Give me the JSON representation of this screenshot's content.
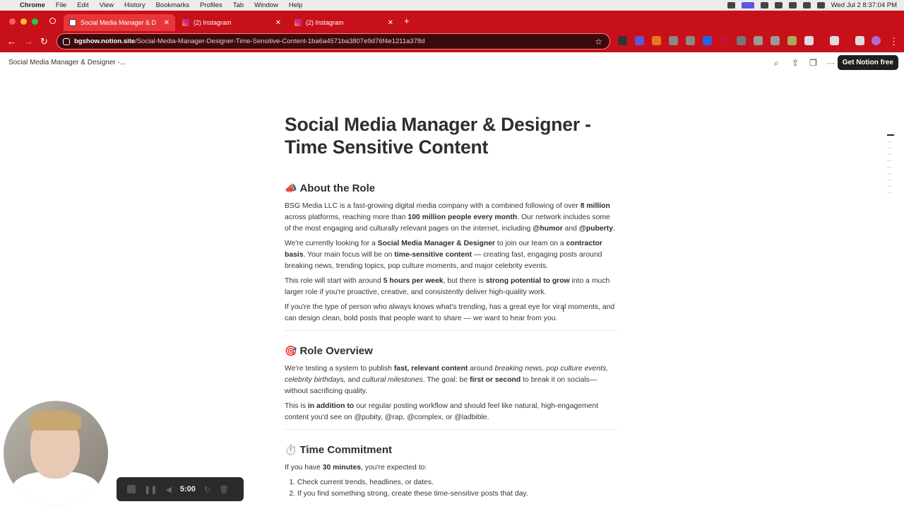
{
  "menubar": {
    "app": "Chrome",
    "items": [
      "File",
      "Edit",
      "View",
      "History",
      "Bookmarks",
      "Profiles",
      "Tab",
      "Window",
      "Help"
    ],
    "clock": "Wed Jul 2  8:37:04 PM"
  },
  "tabs": [
    {
      "label": "Social Media Manager & D",
      "active": true
    },
    {
      "label": "(2) Instagram",
      "active": false
    },
    {
      "label": "(2) Instagram",
      "active": false
    }
  ],
  "address": {
    "host": "bgshow.notion.site",
    "path": "/Social-Media-Manager-Designer-Time-Sensitive-Content-1ba6a4571ba3807e9d76f4e1211a378d"
  },
  "notion_top": {
    "page_title": "Social Media Manager & Designer -...",
    "cta": "Get Notion free"
  },
  "doc": {
    "title": "Social Media Manager & Designer - Time Sensitive Content",
    "about": {
      "emoji": "📣",
      "heading": "About the Role",
      "p1": [
        "BSG Media LLC is a fast-growing digital media company with a combined following of over ",
        "8 million",
        " across platforms, reaching more than ",
        "100 million people every month",
        ". Our network includes some of the most engaging and culturally relevant pages on the internet, including ",
        "@humor",
        " and ",
        "@puberty",
        "."
      ],
      "p2": [
        "We're currently looking for a ",
        "Social Media Manager & Designer",
        " to join our team on a ",
        "contractor basis",
        ". Your main focus will be on ",
        "time-sensitive content",
        " — creating fast, engaging posts around breaking news, trending topics, pop culture moments, and major celebrity events."
      ],
      "p3": [
        "This role will start with around ",
        "5 hours per week",
        ", but there is ",
        "strong potential to grow",
        " into a much larger role if you're proactive, creative, and consistently deliver high-quality work."
      ],
      "p4": "If you're the type of person who always knows what's trending, has a great eye for viral moments, and can design clean, bold posts that people want to share — we want to hear from you."
    },
    "overview": {
      "emoji": "🎯",
      "heading": "Role Overview",
      "p1": [
        "We're testing a system to publish ",
        "fast, relevant content",
        " around ",
        "breaking news, pop culture events, celebrity birthdays,",
        " and ",
        "cultural milestones",
        ". The goal: be ",
        "first or second",
        " to break it on socials—without sacrificing quality."
      ],
      "p2": [
        "This is ",
        "in addition to",
        " our regular posting workflow and should feel like natural, high-engagement content you'd see on @pubity, @rap, @complex, or @ladbible."
      ]
    },
    "commitment": {
      "emoji": "⏱️",
      "heading": "Time Commitment",
      "intro": [
        "If you have ",
        "30 minutes",
        ", you're expected to:"
      ],
      "items": [
        "Check current trends, headlines, or dates.",
        "If you find something strong, create these time-sensitive posts that day."
      ]
    }
  },
  "recorder": {
    "time": "5:00"
  },
  "colors": {
    "chrome_red": "#c8101b",
    "notion_text": "#37352f"
  }
}
